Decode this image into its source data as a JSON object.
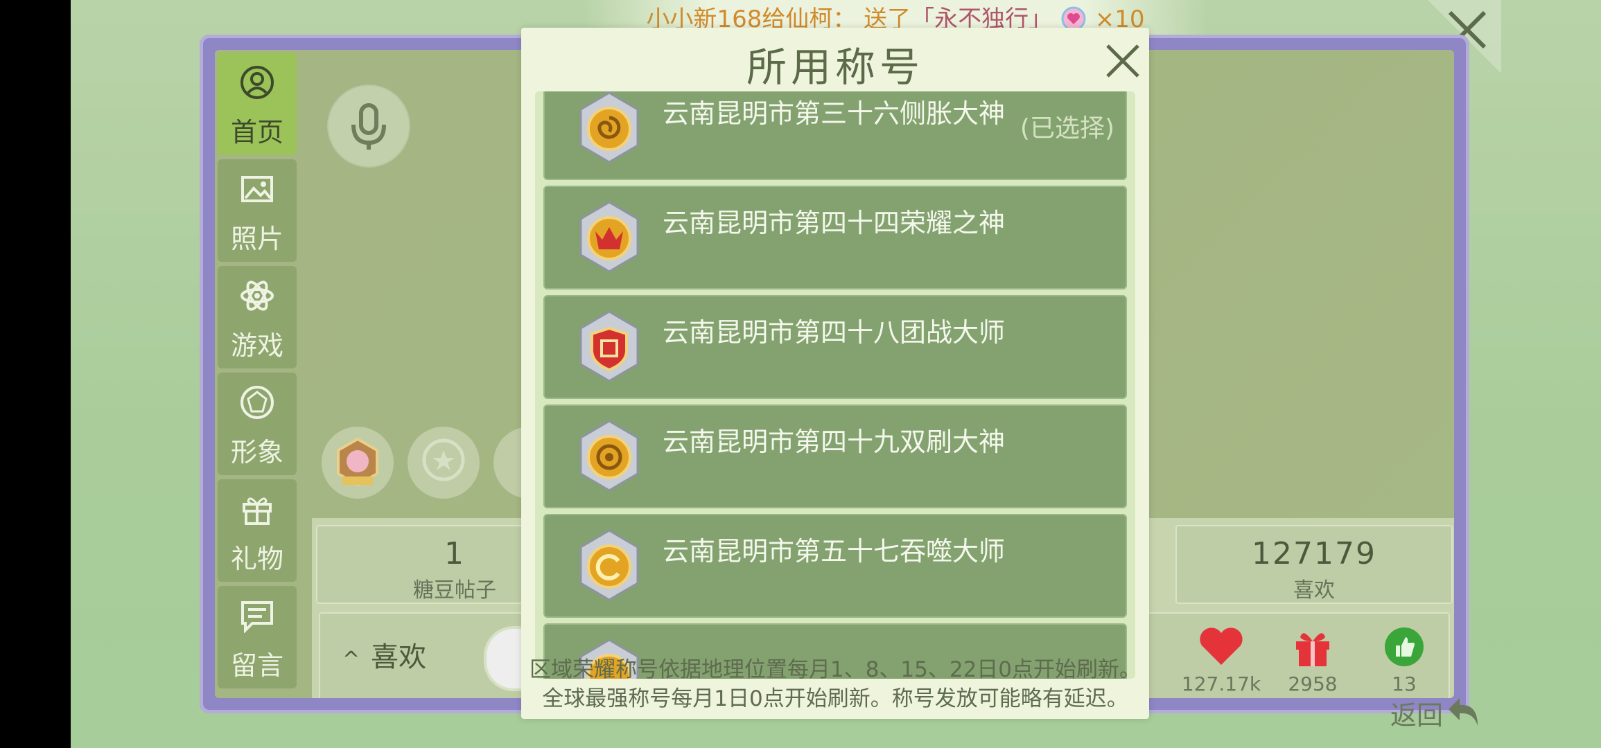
{
  "broadcast": {
    "sender": "小小新168",
    "verb": "给",
    "receiver": "仙柯：",
    "sent": " 送了",
    "gift": "「永不独行」",
    "count": "×10"
  },
  "sidebar": {
    "items": [
      {
        "label": "首页",
        "icon": "user-circle-icon"
      },
      {
        "label": "照片",
        "icon": "image-icon"
      },
      {
        "label": "游戏",
        "icon": "atom-icon"
      },
      {
        "label": "形象",
        "icon": "diamond-icon"
      },
      {
        "label": "礼物",
        "icon": "gift-icon"
      },
      {
        "label": "留言",
        "icon": "message-icon"
      }
    ]
  },
  "stats": {
    "left": {
      "value": "1",
      "label": "糖豆帖子"
    },
    "right": {
      "value": "127179",
      "label": "喜欢"
    }
  },
  "likes_bar": {
    "toggle": "喜欢",
    "hearts": "127.17k",
    "gifts": "2958",
    "thumbs": "13"
  },
  "back_label": "返回",
  "modal": {
    "title": "所用称号",
    "selected_tag": "(已选择)",
    "note_line1": "区域荣耀称号依据地理位置每月1、8、15、22日0点开始刷新。",
    "note_line2": "全球最强称号每月1日0点开始刷新。称号发放可能略有延迟。",
    "titles": [
      {
        "name": "云南昆明市第三十六侧胀大神",
        "medal": "spiral-medal-icon"
      },
      {
        "name": "云南昆明市第四十四荣耀之神",
        "medal": "crown-medal-icon"
      },
      {
        "name": "云南昆明市第四十八团战大师",
        "medal": "team-shield-medal-icon"
      },
      {
        "name": "云南昆明市第四十九双刷大神",
        "medal": "orbit-medal-icon"
      },
      {
        "name": "云南昆明市第五十七吞噬大师",
        "medal": "swirl-medal-icon"
      }
    ]
  },
  "colors": {
    "accent": "#9cc35a",
    "row": "#84a270",
    "frame": "#8f86c6",
    "heart": "#e5333a",
    "thumb": "#3aa63a"
  }
}
